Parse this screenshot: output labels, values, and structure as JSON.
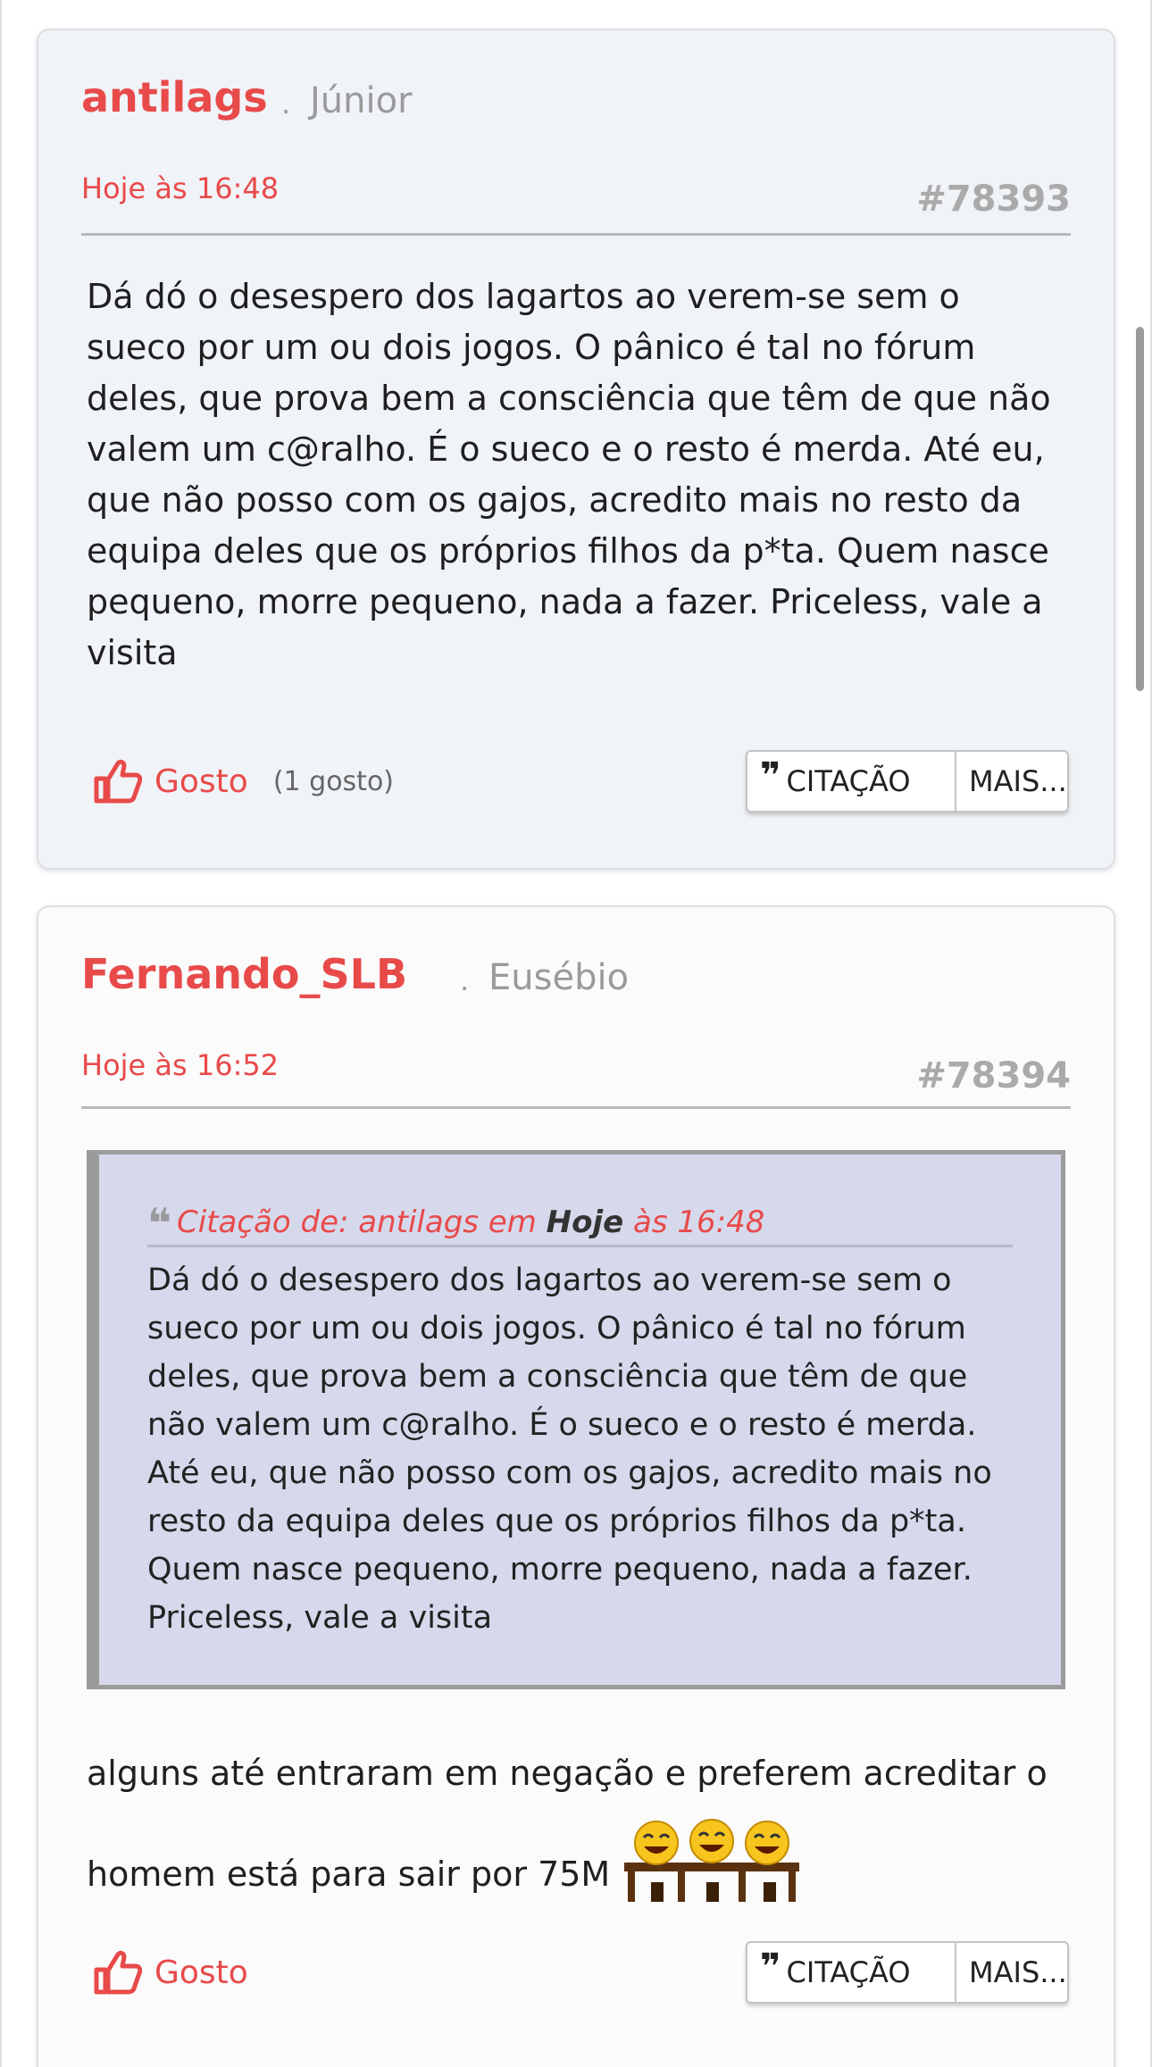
{
  "posts": [
    {
      "username": "antilags",
      "rank": "Júnior",
      "date": "Hoje às 16:48",
      "number": "#78393",
      "body": "Dá dó o desespero dos lagartos ao verem-se sem o sueco por um ou dois jogos. O pânico é tal no fórum deles, que prova bem a consciência que têm de que não valem um c@ralho. É o sueco e o resto é merda. Até eu, que não posso com os gajos, acredito mais no resto da equipa  deles que os próprios filhos da p*ta. Quem nasce pequeno, morre pequeno, nada a fazer. Priceless, vale a visita",
      "like_label": "Gosto",
      "like_count": "(1 gosto)",
      "quote_label": "CITAÇÃO",
      "more_label": "MAIS..."
    },
    {
      "username": "Fernando_SLB",
      "rank": "Eusébio",
      "date": "Hoje às 16:52",
      "number": "#78394",
      "quote": {
        "prefix": "Citação de: antilags em ",
        "bold": "Hoje",
        "suffix": " às 16:48",
        "text": "Dá dó o desespero dos lagartos ao verem-se sem o sueco por um ou dois jogos. O pânico é tal no fórum deles, que prova bem a consciência que têm de que não valem um c@ralho. É o sueco e o resto é merda. Até eu, que não posso com os gajos, acredito mais no resto da equipa  deles que os próprios filhos da p*ta. Quem nasce pequeno, morre pequeno, nada a fazer. Priceless, vale a visita"
      },
      "body": "alguns até entraram em negação e preferem acreditar o homem está para sair por 75M",
      "like_label": "Gosto",
      "quote_label": "CITAÇÃO",
      "more_label": "MAIS..."
    }
  ],
  "icons": {
    "like": "thumbs-up-icon",
    "quote": "quote-marks-icon",
    "emoji": "laughing-at-table-emoji"
  },
  "colors": {
    "accent": "#e84a4a",
    "post_bg_1": "#f0f3f7",
    "post_bg_2": "#fbfbfb",
    "quote_bg": "#d6d9ec",
    "muted": "#9a9a9a"
  }
}
